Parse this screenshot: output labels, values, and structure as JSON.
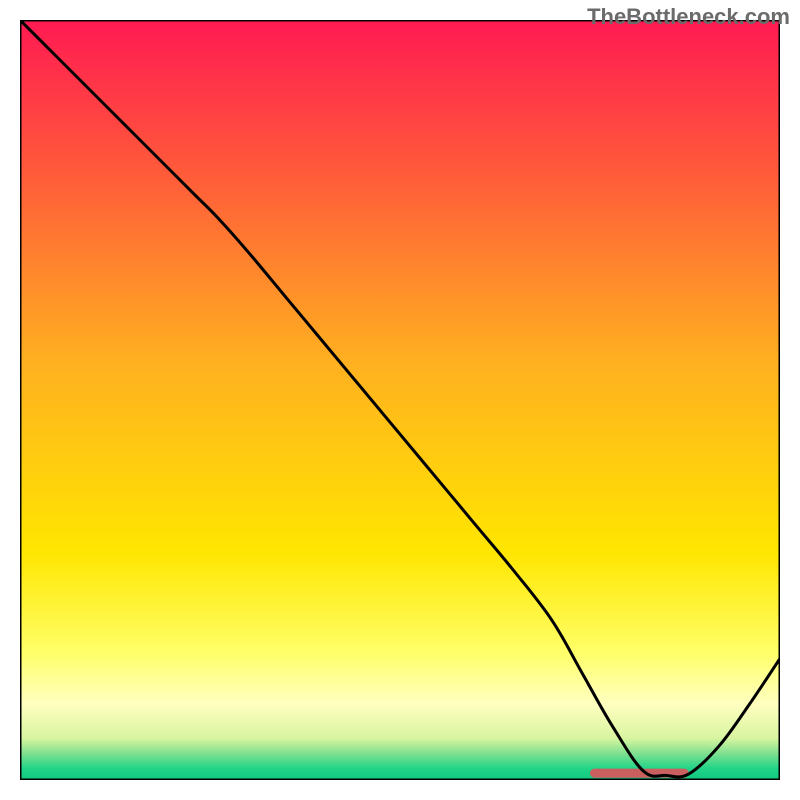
{
  "watermark": "TheBottleneck.com",
  "chart_data": {
    "type": "line",
    "title": "",
    "xlabel": "",
    "ylabel": "",
    "xlim": [
      0,
      100
    ],
    "ylim": [
      0,
      100
    ],
    "grid": false,
    "legend": false,
    "gradient_stops": [
      {
        "offset": 0.0,
        "color": "#ff1a52"
      },
      {
        "offset": 0.2,
        "color": "#ff5a3a"
      },
      {
        "offset": 0.45,
        "color": "#ffb020"
      },
      {
        "offset": 0.7,
        "color": "#ffe600"
      },
      {
        "offset": 0.83,
        "color": "#ffff66"
      },
      {
        "offset": 0.9,
        "color": "#ffffc0"
      },
      {
        "offset": 0.945,
        "color": "#d8f5a0"
      },
      {
        "offset": 0.965,
        "color": "#80e090"
      },
      {
        "offset": 0.985,
        "color": "#20d488"
      },
      {
        "offset": 1.0,
        "color": "#10c880"
      }
    ],
    "series": [
      {
        "name": "curve",
        "color": "#000000",
        "stroke_width": 3,
        "x": [
          0,
          5,
          10,
          15,
          20,
          23,
          26,
          30,
          35,
          40,
          45,
          50,
          55,
          60,
          65,
          70,
          74,
          78,
          82,
          85,
          88,
          92,
          96,
          100
        ],
        "y": [
          100,
          95,
          90,
          85,
          80,
          77,
          74,
          69.5,
          63.5,
          57.5,
          51.5,
          45.5,
          39.5,
          33.5,
          27.5,
          21,
          14,
          7,
          1.2,
          0.6,
          0.8,
          4.5,
          10,
          16
        ]
      }
    ],
    "markers": [
      {
        "name": "flat-segment",
        "type": "bar_segment",
        "color": "#c9605f",
        "x_start": 75,
        "x_end": 88,
        "y": 0.9,
        "height": 1.2
      }
    ]
  }
}
